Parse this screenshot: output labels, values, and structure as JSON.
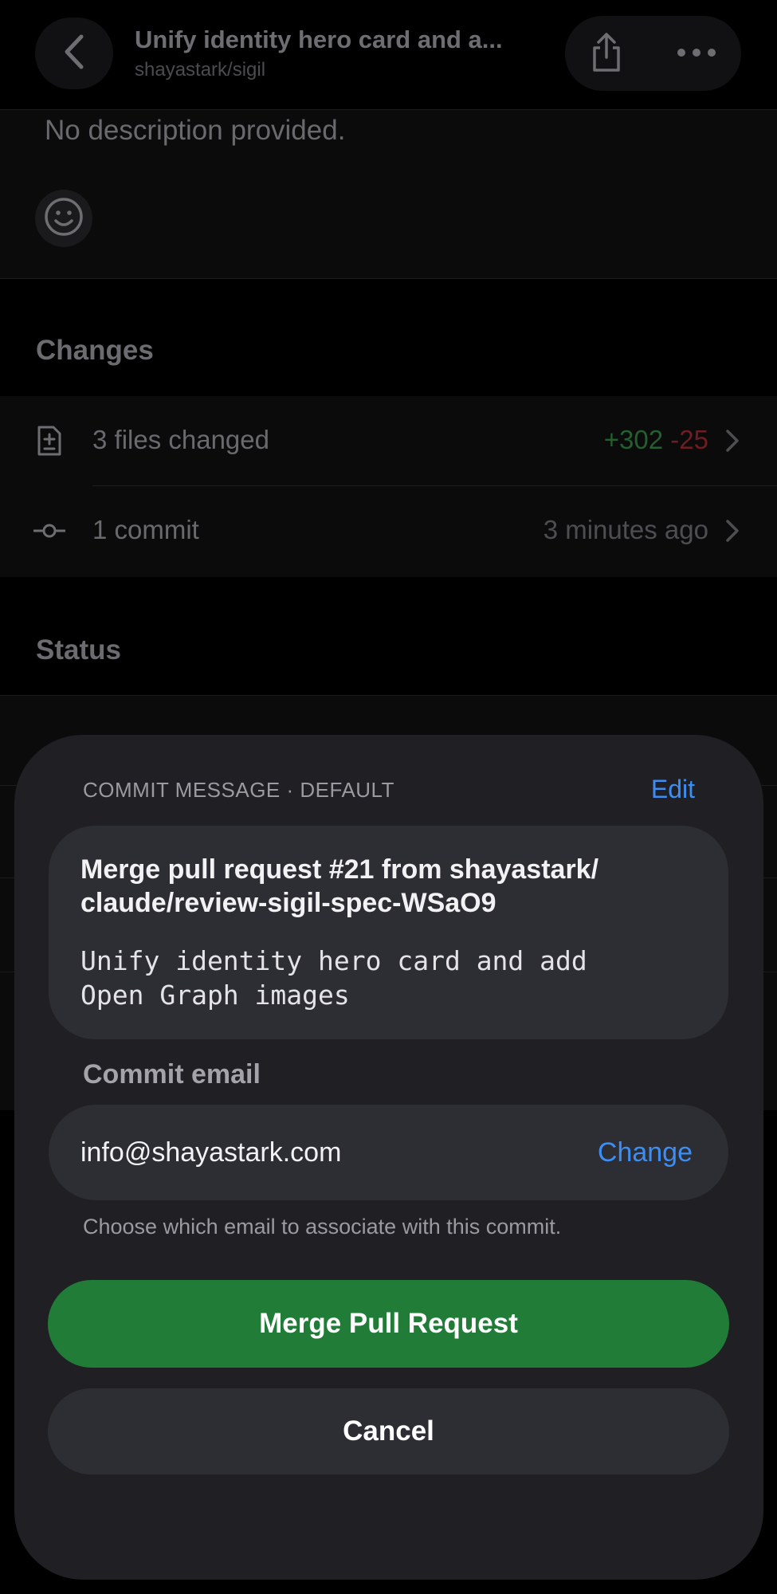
{
  "nav": {
    "title": "Unify identity hero card and a...",
    "subtitle": "shayastark/sigil",
    "back_icon": "chevron-left-icon",
    "share_icon": "share-icon",
    "more_icon": "ellipsis-icon"
  },
  "description": {
    "text": "No description provided.",
    "reaction_icon": "smiley-icon"
  },
  "changes": {
    "header": "Changes",
    "files_label": "3 files changed",
    "additions": "+302",
    "deletions": "-25",
    "commits_label": "1 commit",
    "commits_time": "3 minutes ago"
  },
  "status": {
    "header": "Status"
  },
  "sheet": {
    "kicker": "COMMIT MESSAGE · DEFAULT",
    "edit_label": "Edit",
    "message_title": "Merge pull request #21 from shayastark/\nclaude/review-sigil-spec-WSaO9",
    "message_body": "Unify identity hero card and add\nOpen Graph images",
    "email_label": "Commit email",
    "email_value": "info@shayastark.com",
    "change_label": "Change",
    "email_help": "Choose which email to associate with this commit.",
    "merge_label": "Merge Pull Request",
    "cancel_label": "Cancel"
  },
  "colors": {
    "accent": "#3d8ef2",
    "merge": "#217c38",
    "additions": "#235f2f",
    "deletions": "#6f1d22"
  }
}
